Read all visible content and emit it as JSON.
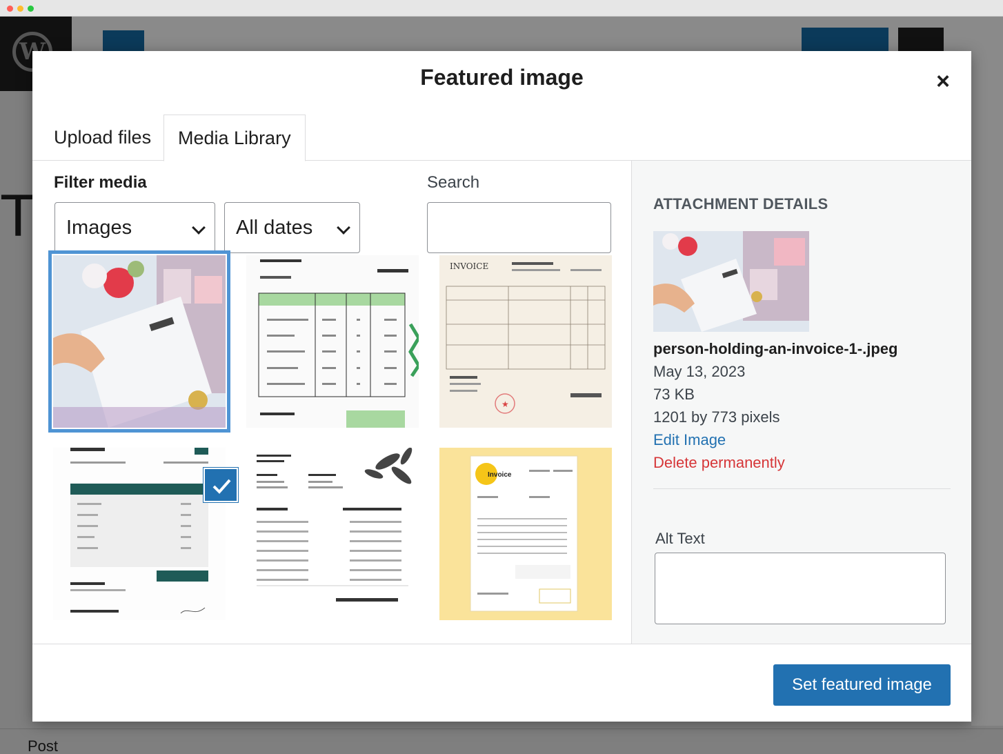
{
  "background": {
    "bottom_label": "Post"
  },
  "modal": {
    "title": "Featured image",
    "close_glyph": "×",
    "tabs": [
      {
        "label": "Upload files",
        "active": false
      },
      {
        "label": "Media Library",
        "active": true
      }
    ],
    "filter": {
      "label": "Filter media",
      "type_select": "Images",
      "date_select": "All dates"
    },
    "search": {
      "label": "Search",
      "value": ""
    },
    "media_items": [
      {
        "kind": "photo",
        "subject": "person holding an invoice",
        "selected": true
      },
      {
        "kind": "invoice",
        "style": "green table invoice",
        "selected": false
      },
      {
        "kind": "invoice",
        "style": "beige invoice with red stamp",
        "selected": false
      },
      {
        "kind": "invoice",
        "style": "dark green header invoice",
        "selected": false
      },
      {
        "kind": "invoice",
        "style": "black and white invoice with leaf",
        "selected": false
      },
      {
        "kind": "invoice",
        "style": "yellow background invoice",
        "selected": false
      }
    ],
    "attachment": {
      "heading": "ATTACHMENT DETAILS",
      "filename": "person-holding-an-invoice-1-.jpeg",
      "date": "May 13, 2023",
      "size": "73 KB",
      "dimensions": "1201 by 773 pixels",
      "edit_link": "Edit Image",
      "delete_link": "Delete permanently",
      "alt_text_label": "Alt Text",
      "alt_text_value": ""
    },
    "primary_button": "Set featured image"
  },
  "colors": {
    "accent": "#2271b1",
    "danger": "#d63638",
    "selection_outline": "#4f94d4"
  }
}
